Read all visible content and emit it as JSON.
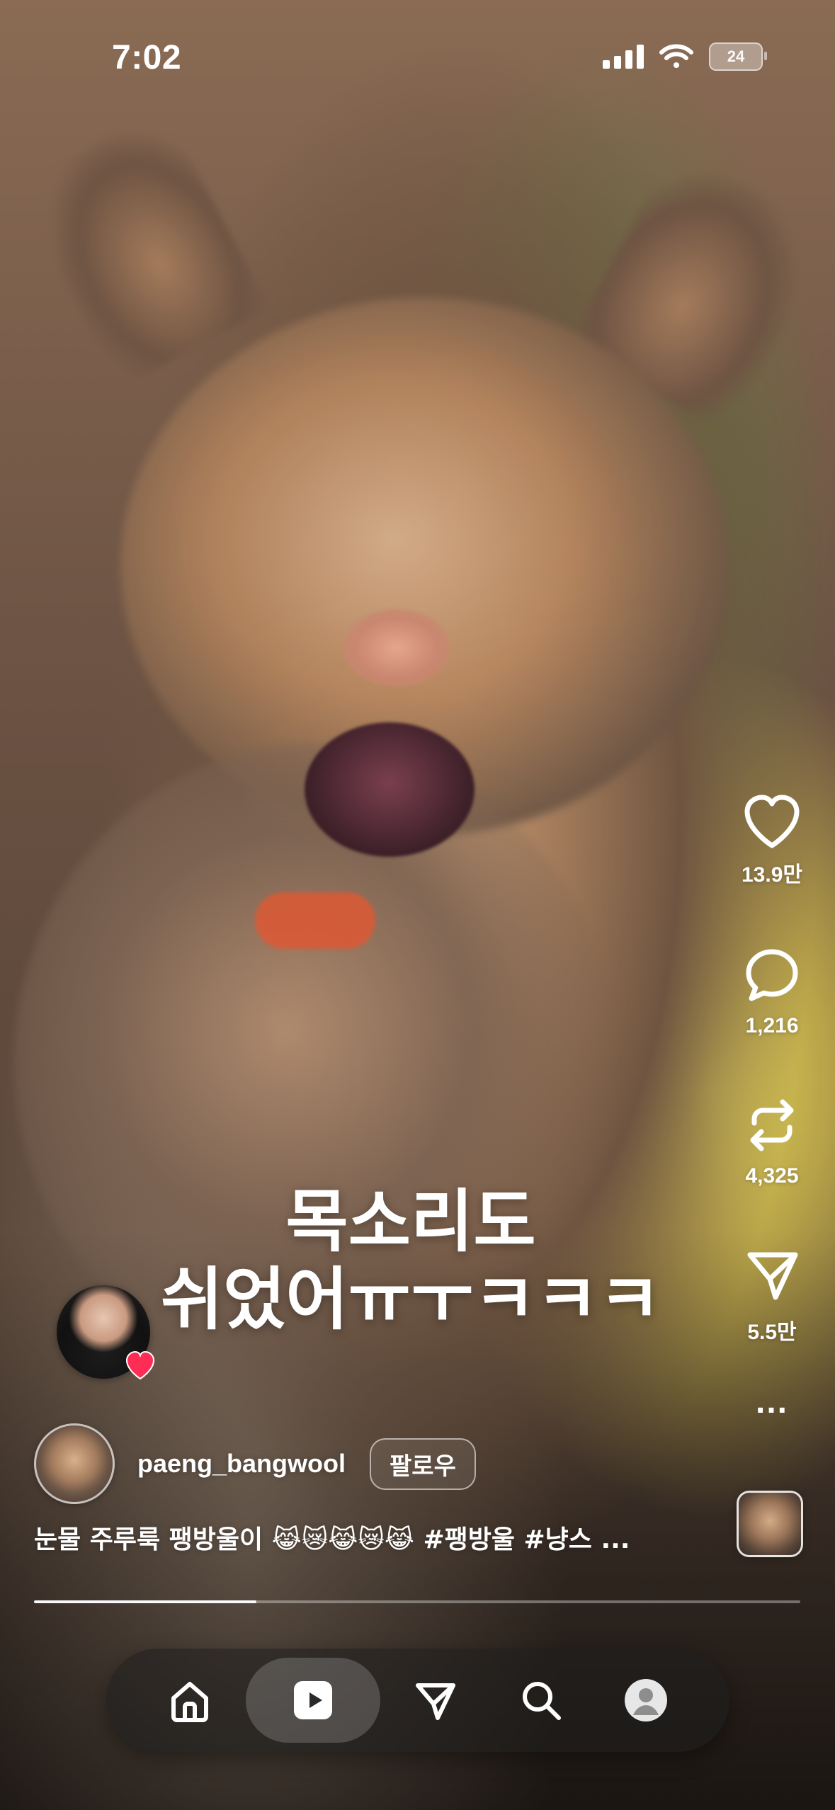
{
  "status_bar": {
    "time": "7:02",
    "battery_level": "24"
  },
  "overlay_caption": {
    "line1": "목소리도",
    "line2": "쉬었어ㅠㅜㅋㅋㅋ"
  },
  "actions": {
    "like_count": "13.9만",
    "comment_count": "1,216",
    "repost_count": "4,325",
    "share_count": "5.5만",
    "more_label": "..."
  },
  "author": {
    "username": "paeng_bangwool",
    "follow_label": "팔로우"
  },
  "post": {
    "caption": "눈물 주루룩 팽방울이 😹😿😹😿😹 #팽방울 #냥스 ..."
  },
  "playback": {
    "progress_fraction": 0.29
  },
  "icons": {
    "like": "heart-icon",
    "comment": "comment-icon",
    "repost": "repost-icon",
    "share": "send-icon",
    "more": "more-icon",
    "home": "home-icon",
    "reels": "reels-icon",
    "messages": "send-icon",
    "search": "search-icon",
    "profile": "profile-icon"
  },
  "colors": {
    "accent_heart": "#ff2d55"
  }
}
